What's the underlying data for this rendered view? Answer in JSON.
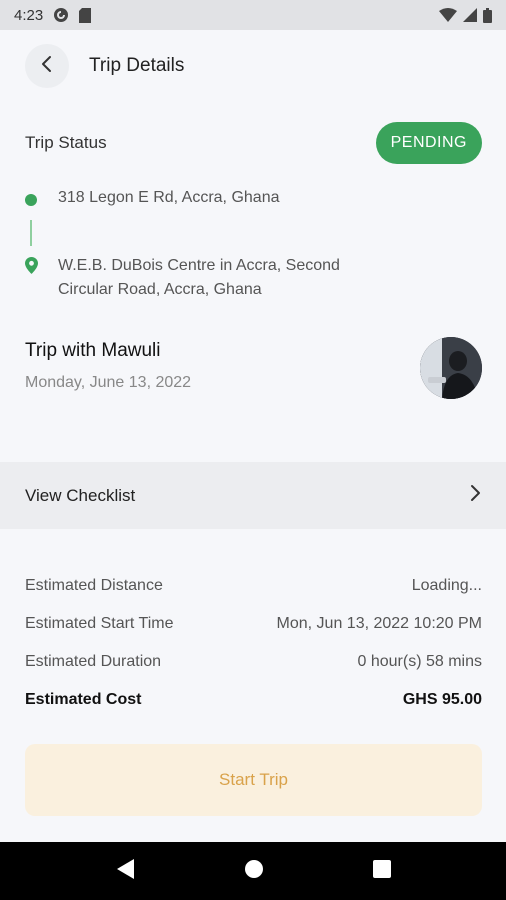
{
  "status_bar": {
    "time": "4:23",
    "icons": [
      "pocket-casts-icon",
      "sd-card-icon",
      "wifi-icon",
      "signal-icon",
      "battery-icon"
    ]
  },
  "header": {
    "title": "Trip Details",
    "back_icon": "chevron-left-icon"
  },
  "trip_status": {
    "label": "Trip Status",
    "badge": "PENDING",
    "badge_color": "#3aa35b"
  },
  "route": {
    "pickup": "318 Legon E Rd, Accra, Ghana",
    "dropoff": "W.E.B. DuBois Centre in Accra, Second Circular Road, Accra, Ghana"
  },
  "trip": {
    "title": "Trip with Mawuli",
    "date": "Monday, June 13, 2022"
  },
  "checklist": {
    "label": "View Checklist",
    "icon": "chevron-right-icon"
  },
  "details": [
    {
      "label": "Estimated Distance",
      "value": "Loading..."
    },
    {
      "label": "Estimated Start Time",
      "value": "Mon, Jun 13, 2022 10:20 PM"
    },
    {
      "label": "Estimated Duration",
      "value": "0 hour(s) 58 mins"
    },
    {
      "label": "Estimated Cost",
      "value": "GHS 95.00"
    }
  ],
  "start_button": {
    "label": "Start Trip",
    "bg_color": "#faf0de",
    "text_color": "#d9a24a"
  },
  "nav": {
    "icons": [
      "back-triangle-icon",
      "home-circle-icon",
      "recents-square-icon"
    ]
  }
}
